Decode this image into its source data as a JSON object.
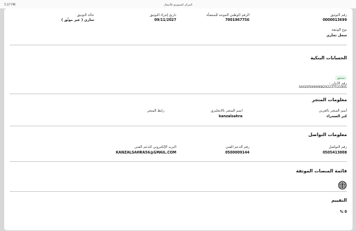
{
  "status_bar": {
    "time": "5:37 PM",
    "url": "المركز السعودي للأعمال"
  },
  "document_info": {
    "doc_number_label": "رقم التوثيق",
    "doc_number_value": "0000013699",
    "national_id_label": "الرقم الوطني الموحد للمنشأة",
    "national_id_value": "7001967756",
    "doc_date_label": "تاريخ إجراء التوثيق",
    "doc_date_value": "09/11/2027",
    "doc_status_label": "حالة التوثيق",
    "doc_status_value": "ساري ( غير موثّق )",
    "doc_type_label": "نوع الوثيقة",
    "doc_type_value": "سجل تجاري"
  },
  "bank_accounts": {
    "title": "الحسابات البنكية",
    "badge": "متحقق",
    "iban_label": "رقم الآيبان :",
    "iban_value": "SA0205000068202237531001"
  },
  "store_info": {
    "title": "معلومات المتجر",
    "name_ar_label": "أسم المتجر بالعربي",
    "name_ar_value": "كنز الصحراء",
    "name_en_label": "اسم المتجر بالانجليزي",
    "name_en_value": "kanzalsahra",
    "link_label": "رابط المتجر"
  },
  "contact_info": {
    "title": "معلومات التواصل",
    "phone_label": "رقم التواصل",
    "phone_value": "0505413008",
    "support_label": "رقم الدعم الفني",
    "support_value": "0500009144",
    "email_label": "البريد الإلكتروني للدعم الفني",
    "email_value": "KANZALSAHRA56@GMAIL.COM"
  },
  "platforms": {
    "title": "قائمة المنصات الموثقة",
    "icon": "globe-icon"
  },
  "rating": {
    "title": "التقييم",
    "value": "0 %"
  }
}
